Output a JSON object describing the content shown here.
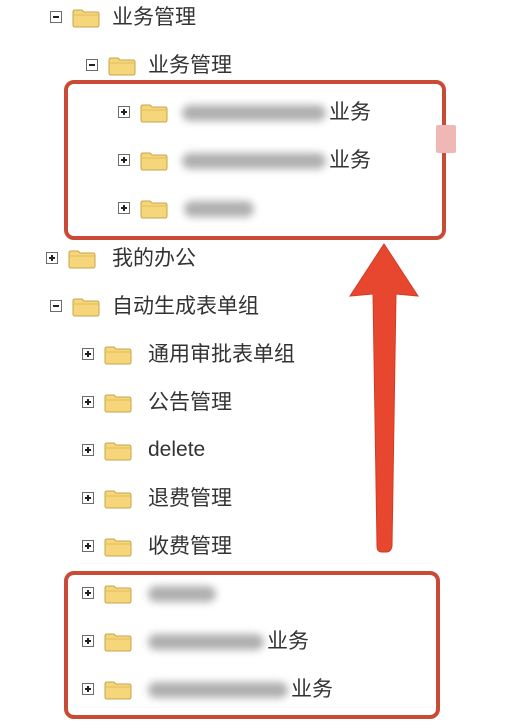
{
  "tree": {
    "nodes": [
      {
        "id": "biz-root",
        "label": "业务管理",
        "level": 0,
        "expanded": true
      },
      {
        "id": "biz-sub",
        "label": "业务管理",
        "level": 1,
        "expanded": true
      },
      {
        "id": "biz-item-1",
        "label": "业务",
        "level": 2,
        "expanded": false,
        "redacted": true
      },
      {
        "id": "biz-item-2",
        "label": "业务",
        "level": 2,
        "expanded": false,
        "redacted": true
      },
      {
        "id": "biz-item-3",
        "label": "",
        "level": 2,
        "expanded": false,
        "redacted": true
      },
      {
        "id": "my-office",
        "label": "我的办公",
        "level": 0,
        "expanded": false
      },
      {
        "id": "auto-forms",
        "label": "自动生成表单组",
        "level": 0,
        "expanded": true
      },
      {
        "id": "general-approval",
        "label": "通用审批表单组",
        "level": 1,
        "expanded": false
      },
      {
        "id": "notice-mgmt",
        "label": "公告管理",
        "level": 1,
        "expanded": false
      },
      {
        "id": "delete",
        "label": "delete",
        "level": 1,
        "expanded": false
      },
      {
        "id": "refund-mgmt",
        "label": "退费管理",
        "level": 1,
        "expanded": false
      },
      {
        "id": "fee-mgmt",
        "label": "收费管理",
        "level": 1,
        "expanded": false
      },
      {
        "id": "auto-item-1",
        "label": "",
        "level": 1,
        "expanded": false,
        "redacted": true
      },
      {
        "id": "auto-item-2",
        "label": "业务",
        "level": 1,
        "expanded": false,
        "redacted": true
      },
      {
        "id": "auto-item-3",
        "label": "业务",
        "level": 1,
        "expanded": false,
        "redacted": true
      }
    ]
  },
  "colors": {
    "highlight": "#c94a35",
    "arrow": "#e8472f",
    "folder": "#f5d67a",
    "text": "#333333"
  }
}
